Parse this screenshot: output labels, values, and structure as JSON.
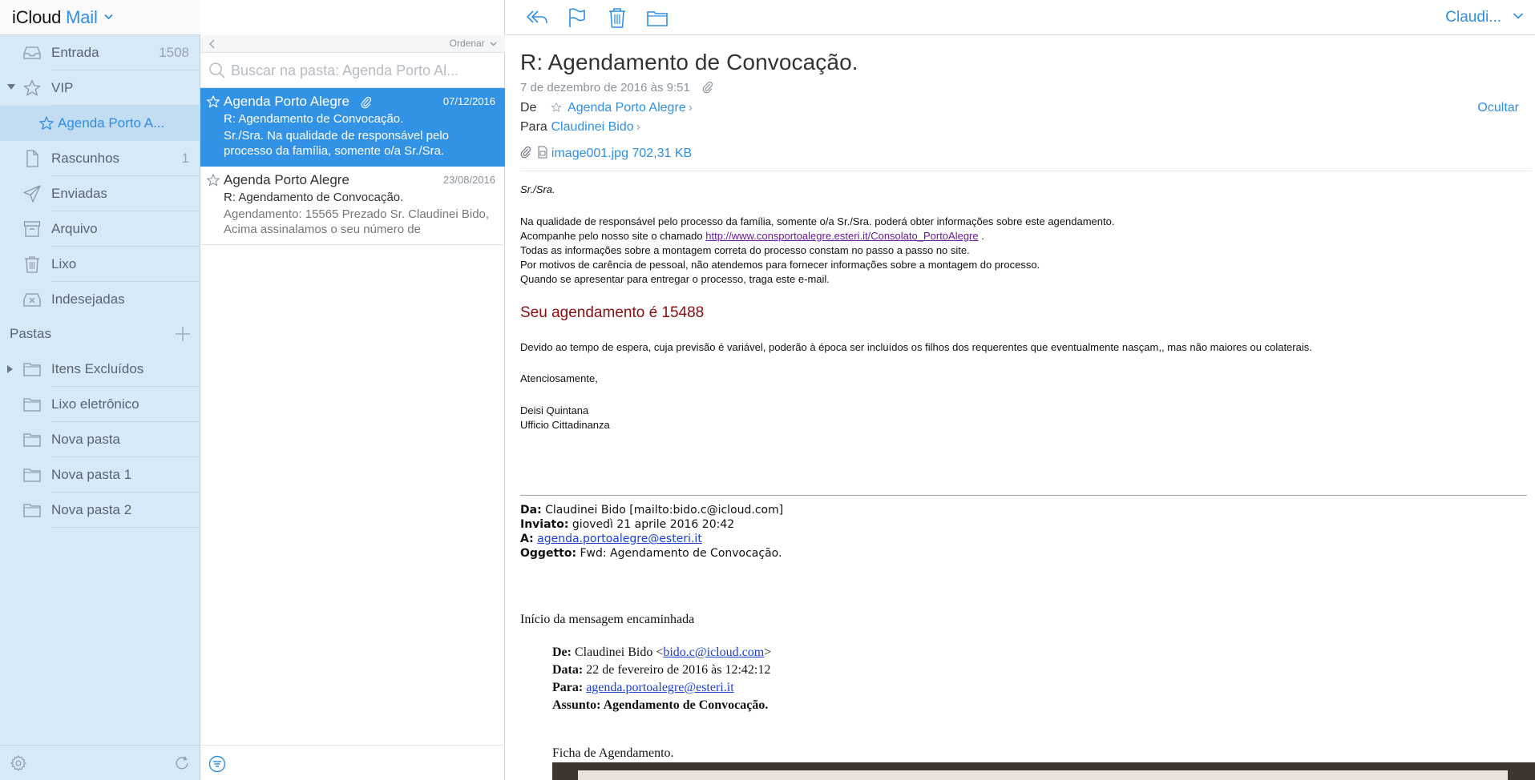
{
  "sidebar": {
    "brand_icloud": "iCloud",
    "brand_mail": "Mail",
    "mailboxes": [
      {
        "label": "Entrada",
        "count": "1508",
        "icon": "inbox-icon"
      },
      {
        "label": "VIP",
        "count": "",
        "icon": "star-icon"
      },
      {
        "label": "Agenda Porto A...",
        "count": "",
        "icon": "star-icon"
      },
      {
        "label": "Rascunhos",
        "count": "1",
        "icon": "draft-icon"
      },
      {
        "label": "Enviadas",
        "count": "",
        "icon": "sent-icon"
      },
      {
        "label": "Arquivo",
        "count": "",
        "icon": "archive-icon"
      },
      {
        "label": "Lixo",
        "count": "",
        "icon": "trash-icon"
      },
      {
        "label": "Indesejadas",
        "count": "",
        "icon": "junk-icon"
      }
    ],
    "folders_header": "Pastas",
    "folders": [
      {
        "label": "Itens Excluídos",
        "icon": "folder-icon"
      },
      {
        "label": "Lixo eletrônico",
        "icon": "folder-icon"
      },
      {
        "label": "Nova pasta",
        "icon": "folder-icon"
      },
      {
        "label": "Nova pasta 1",
        "icon": "folder-icon"
      },
      {
        "label": "Nova pasta 2",
        "icon": "folder-icon"
      }
    ]
  },
  "list": {
    "sort_label": "Ordenar",
    "search_placeholder": "Buscar na pasta: Agenda Porto Al...",
    "messages": [
      {
        "from": "Agenda Porto Alegre",
        "date": "07/12/2016",
        "subject": "R: Agendamento de Convocação.",
        "preview": "Sr./Sra. Na qualidade de responsável pelo processo da família, somente o/a Sr./Sra.",
        "has_attachment": true,
        "selected": true
      },
      {
        "from": "Agenda Porto Alegre",
        "date": "23/08/2016",
        "subject": "R: Agendamento de Convocação.",
        "preview": "Agendamento: 15565 Prezado Sr. Claudinei Bido, Acima assinalamos o seu número de",
        "has_attachment": false,
        "selected": false
      }
    ]
  },
  "toolbar": {
    "account": "Claudi..."
  },
  "message": {
    "subject": "R: Agendamento de Convocação.",
    "datetime": "7 de dezembro de 2016 às 9:51",
    "from_label": "De",
    "from": "Agenda Porto Alegre",
    "to_label": "Para",
    "to": "Claudinei Bido",
    "hide": "Ocultar",
    "attachment_name": "image001.jpg",
    "attachment_size": "702,31 KB",
    "greeting": "Sr./Sra.",
    "para1": "Na qualidade de responsável pelo processo da família, somente o/a Sr./Sra. poderá obter informações sobre este agendamento.",
    "para2_prefix": "Acompanhe pelo nosso site o chamado ",
    "para2_link": "http://www.consportoalegre.esteri.it/Consolato_PortoAlegre",
    "para2_suffix": " .",
    "para3": "Todas as informações sobre a montagem correta do processo constam no passo a passo no site.",
    "para4": "Por motivos de carência de pessoal, não atendemos para fornecer informações sobre a montagem do processo.",
    "para5": "Quando se apresentar para entregar o processo, traga este e-mail.",
    "highlight": "Seu agendamento é 15488",
    "para6": "Devido ao tempo de espera, cuja previsão é variável, poderão à época ser incluídos os filhos dos requerentes que eventualmente nasçam,, mas não maiores ou colaterais.",
    "regards": "Atenciosamente,",
    "sig_name": "Deisi Quintana",
    "sig_office": "Ufficio Cittadinanza",
    "orig_da_label": "Da:",
    "orig_da": " Claudinei Bido [mailto:bido.c@icloud.com]",
    "orig_inviato_label": "Inviato:",
    "orig_inviato": " giovedì 21 aprile 2016 20:42",
    "orig_a_label": "A:",
    "orig_a": "agenda.portoalegre@esteri.it",
    "orig_oggetto_label": "Oggetto:",
    "orig_oggetto": " Fwd: Agendamento de Convocação.",
    "fwd_header": "Início da mensagem encaminhada",
    "fwd_de_label": "De:",
    "fwd_de_name": " Claudinei Bido <",
    "fwd_de_email": "bido.c@icloud.com",
    "fwd_de_close": ">",
    "fwd_data_label": "Data:",
    "fwd_data": " 22 de fevereiro de 2016 às 12:42:12",
    "fwd_para_label": "Para:",
    "fwd_para": "agenda.portoalegre@esteri.it",
    "fwd_assunto_label": "Assunto:",
    "fwd_assunto": " Agendamento de Convocação.",
    "ficha": "Ficha de Agendamento."
  },
  "colors": {
    "accent": "#2f8ee5",
    "sidebar_bg": "#d6e9f9",
    "selection": "#3293e6",
    "highlight_text": "#8b0e0e"
  }
}
